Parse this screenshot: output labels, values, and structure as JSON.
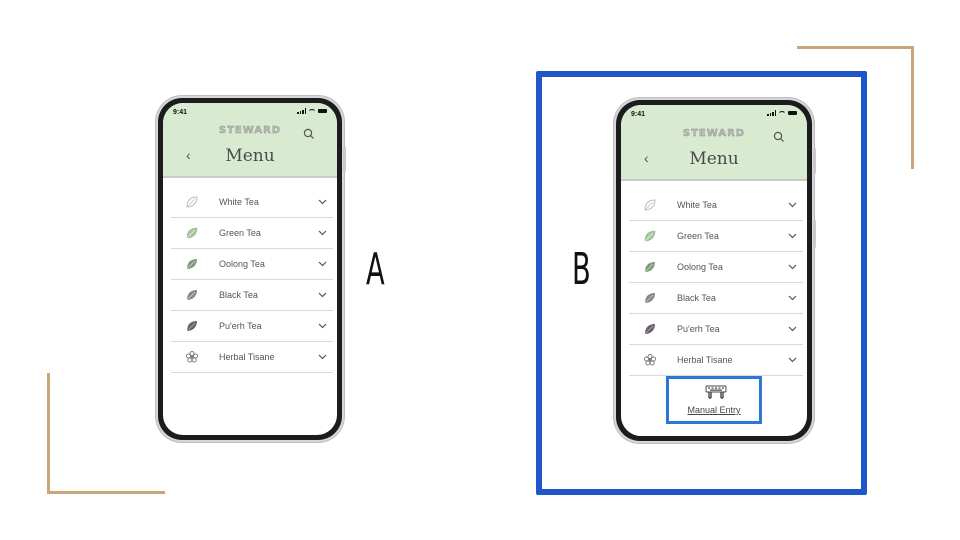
{
  "colors": {
    "accent_tan": "#c8a679",
    "highlight_blue": "#1f57c9",
    "manual_box_blue": "#2b76d6",
    "header_green": "#d8ebd0"
  },
  "labels": {
    "a": "A",
    "b": "B"
  },
  "phone": {
    "status_time": "9:41",
    "brand": "STEWARD",
    "title": "Menu",
    "back_icon": "chevron-left-icon",
    "search_icon": "search-icon",
    "items": [
      {
        "label": "White Tea",
        "icon": "white-leaf-icon",
        "icon_color": "#c7cfc3"
      },
      {
        "label": "Green Tea",
        "icon": "green-leaf-icon",
        "icon_color": "#a8c79e"
      },
      {
        "label": "Oolong Tea",
        "icon": "oolong-leaf-icon",
        "icon_color": "#7e9a7a"
      },
      {
        "label": "Black Tea",
        "icon": "black-leaf-icon",
        "icon_color": "#8a8589"
      },
      {
        "label": "Pu'erh Tea",
        "icon": "puerh-leaf-icon",
        "icon_color": "#6a5e6a"
      },
      {
        "label": "Herbal Tisane",
        "icon": "flower-icon",
        "icon_color": "#777777"
      }
    ]
  },
  "manual_entry": {
    "label": "Manual Entry",
    "icon": "keyboard-hands-icon"
  }
}
